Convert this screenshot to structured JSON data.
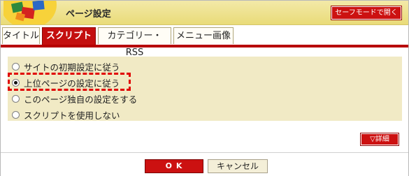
{
  "header": {
    "title": "ページ設定",
    "safe_mode_label": "セーフモードで開く"
  },
  "tabs": [
    {
      "label": "タイトル",
      "active": false
    },
    {
      "label": "スクリプト",
      "active": true
    },
    {
      "label": "カテゴリー・RSS",
      "active": false
    },
    {
      "label": "メニュー画像",
      "active": false
    }
  ],
  "options": [
    {
      "label": "サイトの初期設定に従う",
      "selected": false
    },
    {
      "label": "上位ページの設定に従う",
      "selected": true
    },
    {
      "label": "このページ独自の設定をする",
      "selected": false
    },
    {
      "label": "スクリプトを使用しない",
      "selected": false
    }
  ],
  "detail_label": "▽詳細",
  "footer": {
    "ok_label": "O K",
    "cancel_label": "キャンセル"
  },
  "colors": {
    "accent_red": "#cc1111",
    "header_yellow": "#e9db78",
    "panel_bg": "#f1eac5",
    "highlight": "#e00000"
  }
}
